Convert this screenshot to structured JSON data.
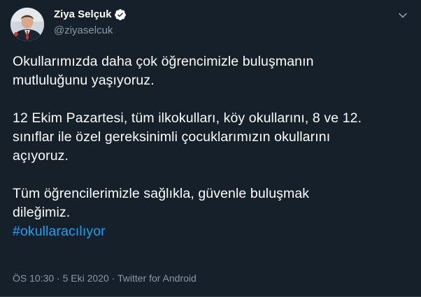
{
  "user": {
    "display_name": "Ziya Selçuk",
    "handle": "@ziyaselcuk",
    "verified": true,
    "verified_color": "#1da1f2"
  },
  "tweet": {
    "paragraph1": [
      "Okullarımızda daha çok öğrencimizle buluşmanın",
      "mutluluğunu yaşıyoruz."
    ],
    "paragraph2": [
      "12 Ekim Pazartesi, tüm ilkokulları, köy okullarını, 8 ve 12.",
      "sınıflar ile özel gereksinimli çocuklarımızın okullarını",
      "açıyoruz."
    ],
    "paragraph3": [
      "Tüm öğrencilerimizle sağlıkla, güvenle buluşmak",
      "dileğimiz."
    ],
    "hashtag": "#okullaracılıyor"
  },
  "meta": {
    "time": "ÖS 10:30",
    "separator": "·",
    "date": "5 Eki 2020",
    "source": "Twitter for Android"
  },
  "icons": {
    "avatar": "profile-photo",
    "verified": "verified-badge-icon",
    "caret": "chevron-down-icon"
  },
  "colors": {
    "background": "#15202b",
    "text": "#ffffff",
    "secondary": "#8899a6",
    "link": "#1da1f2"
  }
}
